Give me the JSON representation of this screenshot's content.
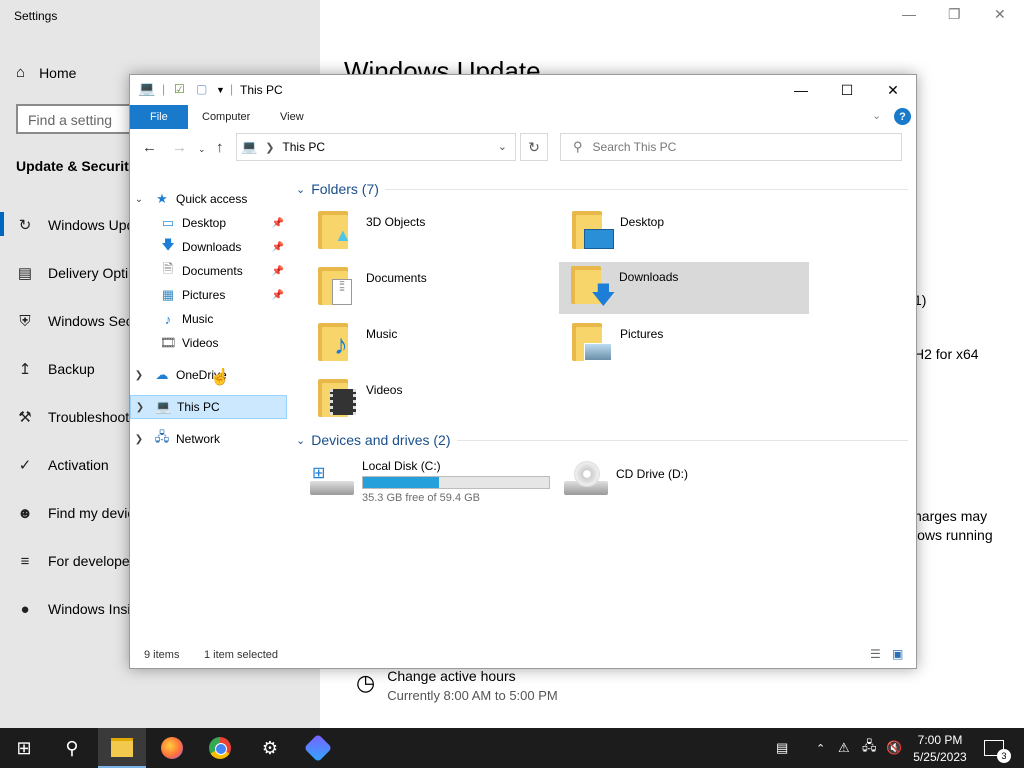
{
  "settings": {
    "title": "Settings",
    "home": "Home",
    "search_placeholder": "Find a setting",
    "section": "Update & Security",
    "nav": [
      "Windows Upd",
      "Delivery Opti",
      "Windows Sec",
      "Backup",
      "Troubleshoot",
      "Activation",
      "Find my devic",
      "For developer",
      "Windows Insi"
    ],
    "main_title": "Windows Update",
    "fragments": [
      "1)",
      "H2 for x64",
      "harges may",
      "lows running"
    ],
    "change_hours": "Change active hours",
    "change_hours_sub": "Currently 8:00 AM to 5:00 PM"
  },
  "explorer": {
    "title": "This PC",
    "ribbon_tabs": [
      "File",
      "Computer",
      "View"
    ],
    "address": "This PC",
    "search_placeholder": "Search This PC",
    "nav_pane": {
      "quick_access": "Quick access",
      "quick_items": [
        "Desktop",
        "Downloads",
        "Documents",
        "Pictures",
        "Music",
        "Videos"
      ],
      "onedrive": "OneDrive",
      "this_pc": "This PC",
      "network": "Network"
    },
    "folders_header": "Folders (7)",
    "folders": [
      "3D Objects",
      "Desktop",
      "Documents",
      "Downloads",
      "Music",
      "Pictures",
      "Videos"
    ],
    "devices_header": "Devices and drives (2)",
    "drives": {
      "c_name": "Local Disk (C:)",
      "c_free": "35.3 GB free of 59.4 GB",
      "c_used_fraction": 0.41,
      "d_name": "CD Drive (D:)"
    },
    "status": {
      "items": "9 items",
      "selected": "1 item selected"
    }
  },
  "taskbar": {
    "time": "7:00 PM",
    "date": "5/25/2023",
    "notifications": "3"
  },
  "colors": {
    "accent": "#1979ca",
    "selection": "#cce8ff",
    "taskbar": "#1c1c1c"
  }
}
